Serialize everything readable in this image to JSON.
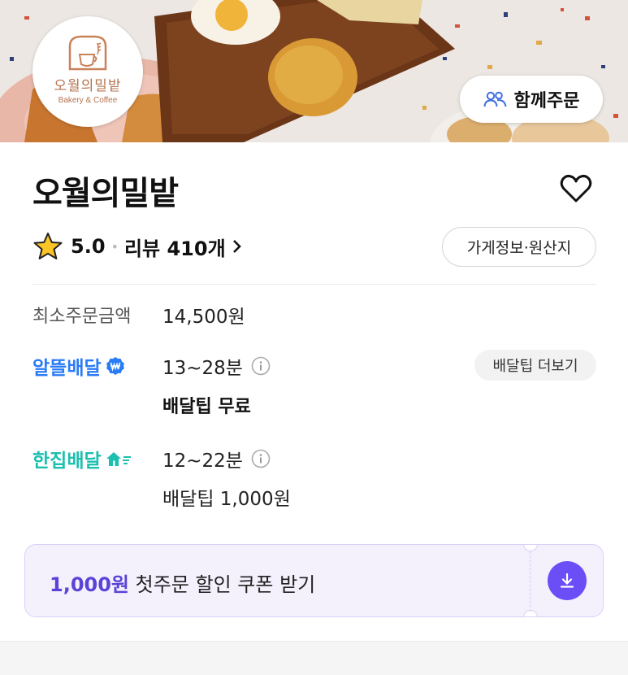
{
  "hero": {
    "logo": {
      "name": "오월의밀밭",
      "sub": "Bakery & Coffee"
    },
    "together_order_label": "함께주문"
  },
  "store": {
    "name": "오월의밀밭",
    "rating": "5.0",
    "review_label": "리뷰 410개",
    "info_button": "가게정보·원산지"
  },
  "min_order": {
    "label": "최소주문금액",
    "value": "14,500원"
  },
  "delivery_options": [
    {
      "brand": "알뜰배달",
      "time": "13~28분",
      "tip": "배달팁 무료",
      "tip_bold": true,
      "brand_color": "#2a7cf6"
    },
    {
      "brand": "한집배달",
      "time": "12~22분",
      "tip": "배달팁 1,000원",
      "tip_bold": false,
      "brand_color": "#1cbfb0"
    }
  ],
  "tip_more_button": "배달팁 더보기",
  "coupon": {
    "amount": "1,000원",
    "text": " 첫주문 할인 쿠폰 받기",
    "accent": "#6b4ef5"
  },
  "icons": [
    "group-icon",
    "heart-icon",
    "star-icon",
    "chevron-right-icon",
    "info-icon",
    "won-badge-icon",
    "house-speed-icon",
    "download-icon"
  ]
}
